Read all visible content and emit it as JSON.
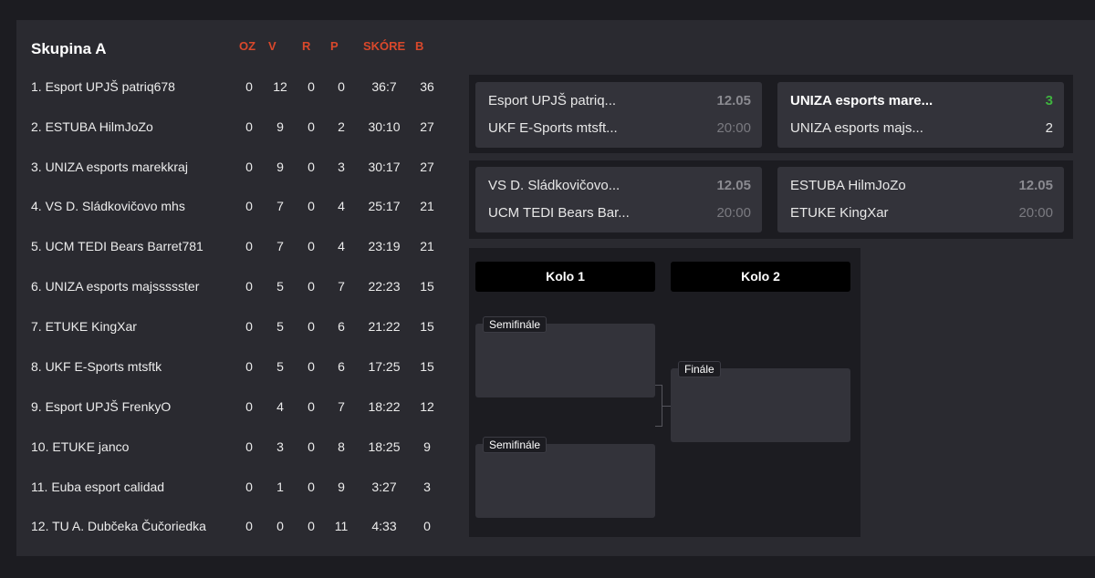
{
  "group": {
    "title": "Skupina A",
    "columns": [
      "OZ",
      "V",
      "R",
      "P",
      "SKÓRE",
      "B"
    ],
    "rows": [
      {
        "name": "1. Esport UPJŠ patriq678",
        "oz": "0",
        "v": "12",
        "r": "0",
        "p": "0",
        "score": "36:7",
        "b": "36"
      },
      {
        "name": "2. ESTUBA HilmJoZo",
        "oz": "0",
        "v": "9",
        "r": "0",
        "p": "2",
        "score": "30:10",
        "b": "27"
      },
      {
        "name": "3. UNIZA esports marekkraj",
        "oz": "0",
        "v": "9",
        "r": "0",
        "p": "3",
        "score": "30:17",
        "b": "27"
      },
      {
        "name": "4. VS D. Sládkovičovo mhs",
        "oz": "0",
        "v": "7",
        "r": "0",
        "p": "4",
        "score": "25:17",
        "b": "21"
      },
      {
        "name": "5. UCM TEDI Bears Barret781",
        "oz": "0",
        "v": "7",
        "r": "0",
        "p": "4",
        "score": "23:19",
        "b": "21"
      },
      {
        "name": "6. UNIZA esports majssssster",
        "oz": "0",
        "v": "5",
        "r": "0",
        "p": "7",
        "score": "22:23",
        "b": "15"
      },
      {
        "name": "7. ETUKE KingXar",
        "oz": "0",
        "v": "5",
        "r": "0",
        "p": "6",
        "score": "21:22",
        "b": "15"
      },
      {
        "name": "8. UKF E-Sports mtsftk",
        "oz": "0",
        "v": "5",
        "r": "0",
        "p": "6",
        "score": "17:25",
        "b": "15"
      },
      {
        "name": "9. Esport UPJŠ FrenkyO",
        "oz": "0",
        "v": "4",
        "r": "0",
        "p": "7",
        "score": "18:22",
        "b": "12"
      },
      {
        "name": "10. ETUKE janco",
        "oz": "0",
        "v": "3",
        "r": "0",
        "p": "8",
        "score": "18:25",
        "b": "9"
      },
      {
        "name": "11. Euba esport calidad",
        "oz": "0",
        "v": "1",
        "r": "0",
        "p": "9",
        "score": "3:27",
        "b": "3"
      },
      {
        "name": "12. TU A. Dubčeka Čučoriedka",
        "oz": "0",
        "v": "0",
        "r": "0",
        "p": "11",
        "score": "4:33",
        "b": "0"
      }
    ]
  },
  "matches": {
    "m1": {
      "team1": "Esport UPJŠ patriq...",
      "team2": "UKF E-Sports mtsft...",
      "date": "12.05",
      "time": "20:00"
    },
    "m2": {
      "team1": "UNIZA esports mare...",
      "team2": "UNIZA esports majs...",
      "score1": "3",
      "score2": "2"
    },
    "m3": {
      "team1": "VS D. Sládkovičovo...",
      "team2": "UCM TEDI Bears Bar...",
      "date": "12.05",
      "time": "20:00"
    },
    "m4": {
      "team1": "ESTUBA HilmJoZo",
      "team2": "ETUKE KingXar",
      "date": "12.05",
      "time": "20:00"
    }
  },
  "bracket": {
    "round1": "Kolo 1",
    "round2": "Kolo 2",
    "semi1": "Semifinále",
    "semi2": "Semifinále",
    "final": "Finále"
  }
}
